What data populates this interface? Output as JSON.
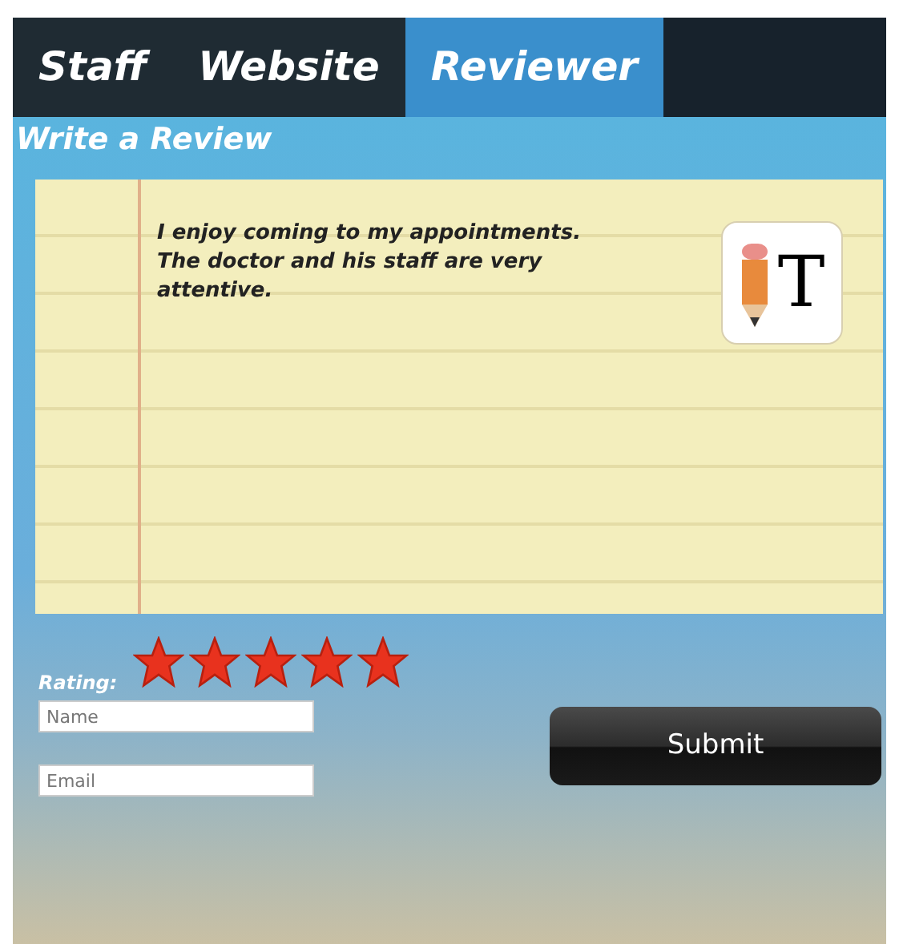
{
  "tabs": [
    {
      "label": "Staff",
      "selected": false
    },
    {
      "label": "Website",
      "selected": false
    },
    {
      "label": "Reviewer",
      "selected": true
    }
  ],
  "heading": "Write a Review",
  "review": {
    "text": "I enjoy coming to my appointments. The doctor and his staff are very attentive.",
    "icon_glyph": "T"
  },
  "rating": {
    "label": "Rating:",
    "stars": 5
  },
  "fields": [
    {
      "placeholder": "Name"
    },
    {
      "placeholder": "Email"
    }
  ],
  "submit": "Submit"
}
